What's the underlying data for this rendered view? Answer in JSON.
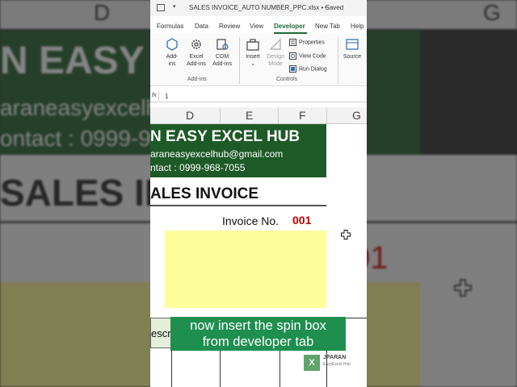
{
  "background": {
    "col_letters": [
      "D",
      "G"
    ],
    "banner_line1": "N EASY EX",
    "banner_line2": "araneasyexcelhub",
    "banner_line3": "ontact : 0999-968",
    "sales_text": "SALES INVO",
    "number_text": "01"
  },
  "titlebar": {
    "filename": "SALES INVOICE_AUTO NUMBER_PPC.xlsx",
    "status": "Saved"
  },
  "ribbon_tabs": [
    "Formulas",
    "Data",
    "Review",
    "View",
    "Developer",
    "New Tab",
    "Help"
  ],
  "ribbon": {
    "addins_buttons": [
      {
        "label1": "Add-",
        "label2": "ins"
      },
      {
        "label1": "Excel",
        "label2": "Add-ins"
      },
      {
        "label1": "COM",
        "label2": "Add-ins"
      }
    ],
    "addins_group": "Add-ins",
    "insert_label": "Insert",
    "design_mode": {
      "label1": "Design",
      "label2": "Mode"
    },
    "properties": "Properties",
    "view_code": "View Code",
    "run_dialog": "Run Dialog",
    "controls_group": "Controls",
    "source_label": "Source"
  },
  "formula_bar": {
    "fx": "fx",
    "value": "1"
  },
  "columns": [
    "D",
    "E",
    "F",
    "G"
  ],
  "sheet": {
    "banner_title": "N EASY EXCEL HUB",
    "banner_email": "araneasyexcelhub@gmail.com",
    "banner_contact": "ntact : 0999-968-7055",
    "sales_title": "ALES INVOICE",
    "invoice_label": "Invoice No.",
    "invoice_number": "001",
    "descr_cell": "escri"
  },
  "caption": {
    "line1": "now insert the spin box",
    "line2": "from developer tab"
  },
  "logo": {
    "mark": "X",
    "name": "JPARAN",
    "sub": "EasyExcel Hub"
  },
  "colors": {
    "banner_green": "#1e5a27",
    "caption_green": "#1e8f4e",
    "yellow_fill": "#fdfd9b",
    "invoice_red": "#c00000",
    "accent_tab": "#1d6b35"
  }
}
